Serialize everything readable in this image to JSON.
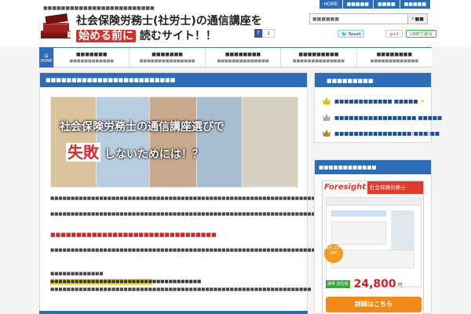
{
  "header": {
    "tagline": "■■■■■■■■■■■■■■■■■■■■■■■■■",
    "title_line1": "社会保険労務士(社労士)の通信講座を",
    "title_highlight": "始める前に",
    "title_rest": "読むサイト！！",
    "top_nav": [
      "HOME",
      "■■■■■",
      "■■■■",
      "■■■■■"
    ],
    "search_placeholder": "■■■■■■",
    "search_button": "■■",
    "fb_count": "1",
    "tweet_label": "Tweet",
    "gplus_label": "g+1",
    "line_label": "LINEで送る"
  },
  "nav": {
    "home": "HOME",
    "items": [
      {
        "title": "■■■■■■■",
        "sub": "■■■■■■■■■■■■"
      },
      {
        "title": "■■■■■■■",
        "sub": "■■■■■■■■■■■■■■■"
      },
      {
        "title": "■■■■■■■■",
        "sub": "■■■■■■■■■■■■■■"
      },
      {
        "title": "■■■■■■■■■",
        "sub": "■■■■■■■■■■■■■■"
      },
      {
        "title": "■■■■■■■■",
        "sub": "■■■■■■■■■■■■■"
      }
    ]
  },
  "article": {
    "heading": "■■■■■■■■■■■■■■■■■■■■■■■■■",
    "hero_line1": "社会保険労務士の通信講座選びで",
    "hero_fail": "失敗",
    "hero_line2_rest": "しないためには！？",
    "para1": "■■■■■■■■■■■■■■■■■■■■■■■■■■■■■■■■■■■■■■■■■■■■■■■■■■■■■■■■■■■■■■■■■■■■■■■■",
    "para2": "■■■■■■■■■■■■■■■■■■■■■■■■■■■■■■■■■■■■■■■■■■■■■■■■■■■■■■■■■■■■■■■■■■■■■■■■■",
    "red_text": "■■■■■■■■■■■■■■■■■■■■■■■■■■■■■■■■",
    "para3": "■■■■■■■■■■■■■■■■■■■■■■■■■■■■■■■■■■■■■■■■■■■■■■■■■■■■■■■■■■■■■■■■■■■■■■■■■■■■■■■■■■■■■■",
    "label": "■■■■■■■■■■■■■",
    "link": "■■■■■■■■■■■■■■■■■■■■■■■■■■■■■■■■■■■■■",
    "para4": "■■■■■■■■■■■■■■■■■■■■■■■■■■■■■■■■■■■■■■■■■■■■■■■■■■■■■■■■■■■■■■■■"
  },
  "ranking": {
    "heading": "■■■■■■■■■",
    "items": [
      {
        "label": "■■■■■■■■■■■■ ■■■■■",
        "crown": "gold"
      },
      {
        "label": "■■■■■■■■■■■■■■■■■ ■■■■■",
        "crown": "silver"
      },
      {
        "label": "■■■■■■■■■■■■■■■■(■■■)■■",
        "crown": "bronze"
      }
    ]
  },
  "ad": {
    "heading": "■■■■■■■■■■■■",
    "brand": "Foresight",
    "brand_sub": "社会保険労務士",
    "badge": "最大 23% OFF",
    "price_label": "通常 割引後",
    "price": "24,800",
    "price_unit": "円",
    "detail_button": "詳細はこちら"
  },
  "colors": {
    "primary": "#2c6cb8",
    "accent_red": "#d0282a",
    "orange": "#f28a1a"
  }
}
